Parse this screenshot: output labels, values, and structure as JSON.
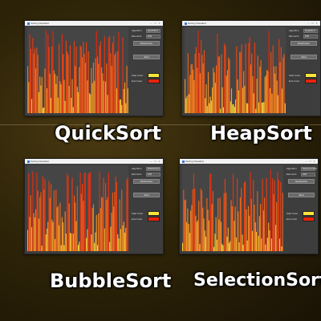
{
  "window_title": "Sorting Visualizer",
  "colors": {
    "start": "#f7e43a",
    "end": "#e8230b"
  },
  "panel": {
    "algorithm_label": "Algorithm",
    "elements_label": "Elements",
    "randomize_label": "Randomize",
    "start_label": "Start",
    "start_color_label": "Start Color",
    "end_color_label": "End Color"
  },
  "windows": [
    {
      "caption": "QuickSort",
      "algorithm": "QuickSort",
      "elements": "100"
    },
    {
      "caption": "HeapSort",
      "algorithm": "HeapSort",
      "elements": "100"
    },
    {
      "caption": "BubbleSort",
      "algorithm": "BubbleSort",
      "elements": "100"
    },
    {
      "caption": "SelectionSort",
      "algorithm": "SelectionSort",
      "elements": "100"
    }
  ]
}
